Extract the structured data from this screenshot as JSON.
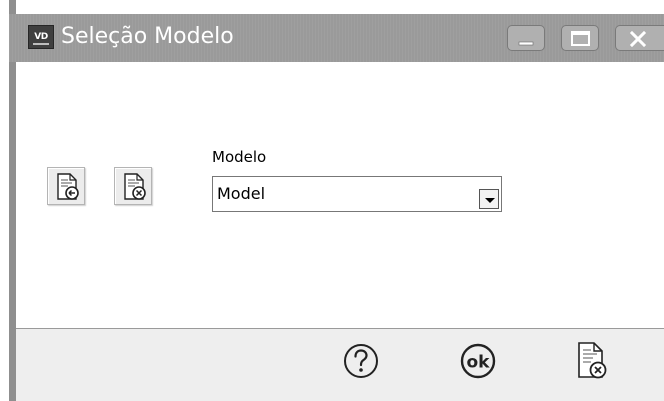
{
  "window": {
    "title": "Seleção Modelo",
    "app_icon_text": "VD",
    "controls": {
      "minimize": "minimize-icon",
      "maximize": "maximize-icon",
      "close": "close-icon"
    }
  },
  "toolbar": {
    "apply_icon": "document-arrow-icon",
    "clear_icon": "document-cancel-icon"
  },
  "form": {
    "modelo_label": "Modelo",
    "modelo_value": "Model",
    "dropdown_icon": "chevron-down-icon"
  },
  "footer": {
    "help_icon": "help-icon",
    "ok_label": "ok",
    "cancel_icon": "document-cancel-icon"
  },
  "colors": {
    "titlebar": "#9a9a9a",
    "footer": "#eeeeee",
    "icon_stroke": "#222222"
  }
}
